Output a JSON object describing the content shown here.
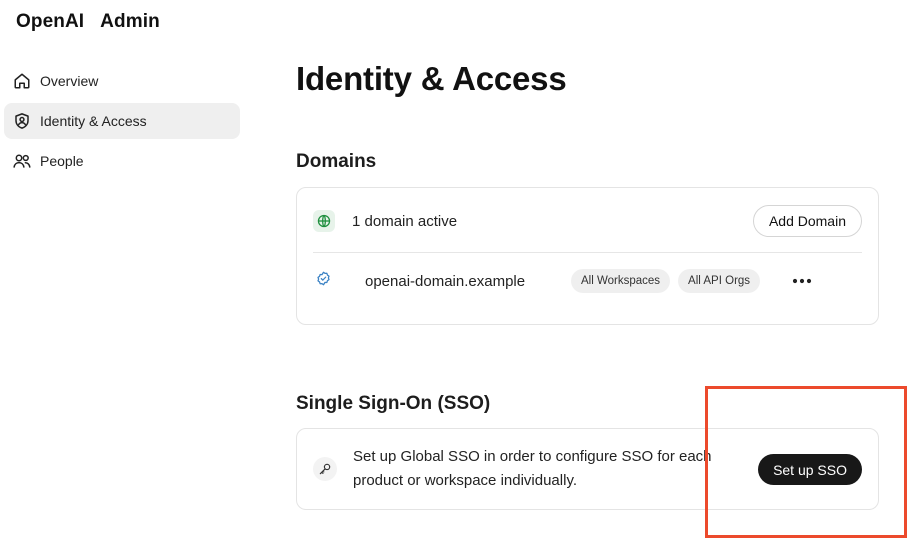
{
  "header": {
    "brand": "OpenAI",
    "product": "Admin"
  },
  "sidebar": {
    "items": [
      {
        "label": "Overview",
        "icon": "home-icon",
        "active": false
      },
      {
        "label": "Identity & Access",
        "icon": "user-shield-icon",
        "active": true
      },
      {
        "label": "People",
        "icon": "people-icon",
        "active": false
      }
    ]
  },
  "main": {
    "title": "Identity & Access",
    "domains": {
      "title": "Domains",
      "status": "1 domain active",
      "add_button": "Add Domain",
      "rows": [
        {
          "name": "openai-domain.example",
          "tags": [
            "All Workspaces",
            "All API Orgs"
          ],
          "menu_icon": "more-horizontal-icon"
        }
      ]
    },
    "sso": {
      "title": "Single Sign-On (SSO)",
      "description": "Set up Global SSO in order to configure SSO for each product or workspace individually.",
      "button": "Set up SSO"
    }
  },
  "colors": {
    "accent_dark": "#181818",
    "active_nav_bg": "#efefef",
    "globe_green": "#1e8f3e",
    "verified_blue": "#3b82c4",
    "highlight": "#ec4a2c"
  }
}
